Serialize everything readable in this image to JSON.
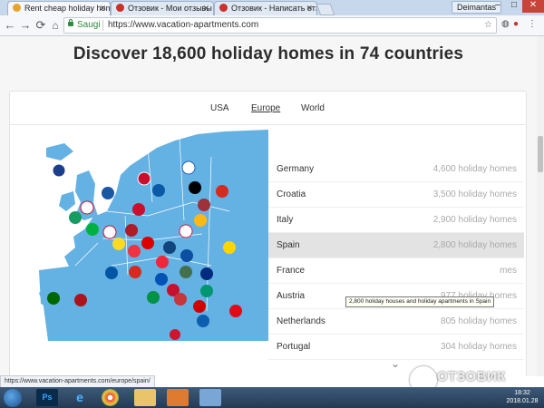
{
  "browser": {
    "tabs": [
      {
        "title": "Rent cheap holiday hom",
        "active": true,
        "color": "#e8a32a"
      },
      {
        "title": "Отзовик - Мои отзывы",
        "active": false,
        "color": "#c8322a"
      },
      {
        "title": "Отзовик - Написать отз",
        "active": false,
        "color": "#c8322a"
      }
    ],
    "profile_name": "Deimantas",
    "secure_label": "Saugi",
    "url": "https://www.vacation-apartments.com"
  },
  "page": {
    "heading": "Discover 18,600 holiday homes in 74 countries",
    "region_tabs": [
      "USA",
      "Europe",
      "World"
    ],
    "selected_region": "Europe",
    "rows": [
      {
        "country": "Germany",
        "count": "4,600 holiday homes"
      },
      {
        "country": "Croatia",
        "count": "3,500 holiday homes"
      },
      {
        "country": "Italy",
        "count": "2,900 holiday homes"
      },
      {
        "country": "Spain",
        "count": "2,800 holiday homes",
        "highlight": true
      },
      {
        "country": "France",
        "count": "mes"
      },
      {
        "country": "Austria",
        "count": "977 holiday homes"
      },
      {
        "country": "Netherlands",
        "count": "805 holiday homes"
      },
      {
        "country": "Portugal",
        "count": "304 holiday homes"
      }
    ],
    "tooltip": "2,800 holiday houses and holiday apartments in Spain",
    "status_url": "https://www.vacation-apartments.com/europe/spain/"
  },
  "taskbar": {
    "apps": [
      "Ps",
      "e",
      "Chrome",
      "Explorer",
      "Media",
      "Window"
    ],
    "time": "18:32",
    "date": "2018.01.28"
  },
  "watermark": "ОТЗОВИК",
  "colors": {
    "map_sea": "#64b1e3",
    "map_land": "#ffffff",
    "highlight": "#e3e3e3"
  }
}
